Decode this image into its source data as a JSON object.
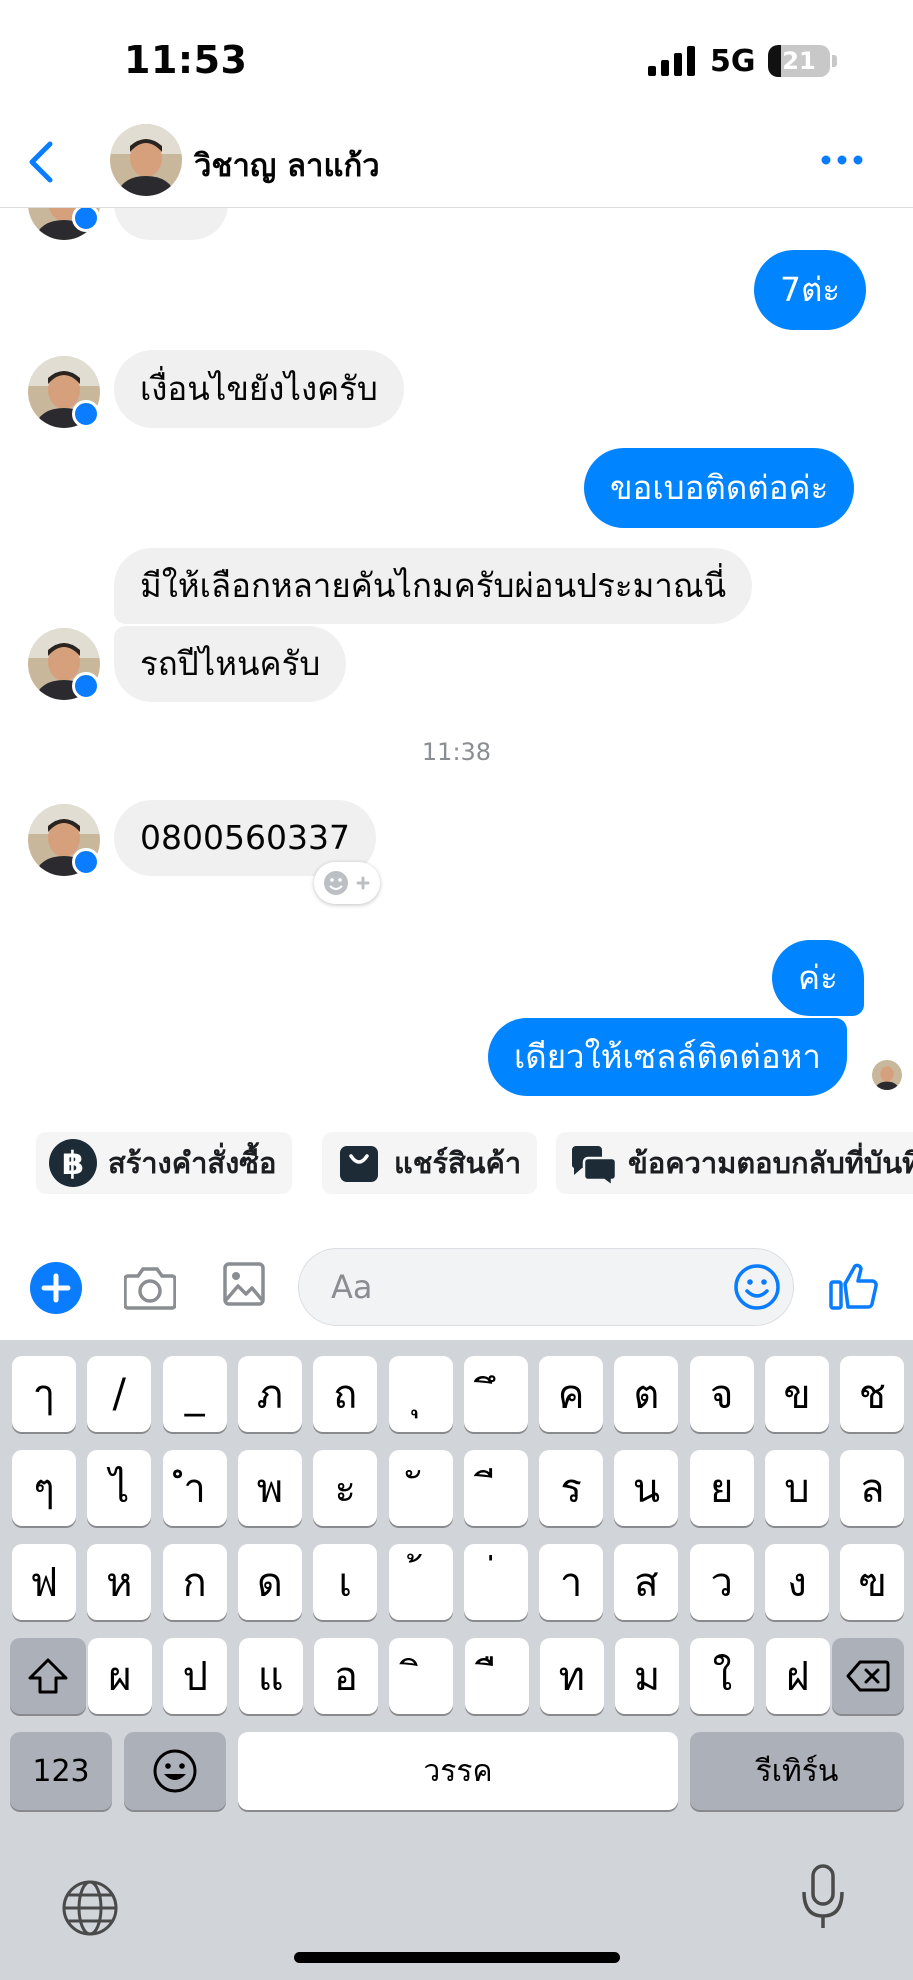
{
  "status_bar": {
    "time": "11:53",
    "network": "5G",
    "battery_level": "21",
    "battery_fraction": 0.21
  },
  "header": {
    "contact_name": "วิชาญ ลาแก้ว",
    "back_icon": "chevron-left-icon",
    "more_icon": "more-horizontal-icon"
  },
  "messages": [
    {
      "direction": "out",
      "text": "7ต่ะ"
    },
    {
      "direction": "in",
      "text": "เงื่อนไขยังไงครับ"
    },
    {
      "direction": "out",
      "text": "ขอเบอติดต่อค่ะ"
    },
    {
      "direction": "in",
      "text": "มีให้เลือกหลายคันไกมครับผ่อนประมาณนี่"
    },
    {
      "direction": "in",
      "text": "รถปีไหนครับ"
    },
    {
      "direction": "in",
      "text": "0800560337"
    },
    {
      "direction": "out",
      "text": "ค่ะ"
    },
    {
      "direction": "out",
      "text": "เดียวให้เซลล์ติดต่อหา"
    }
  ],
  "timestamp": "11:38",
  "quick_replies": [
    {
      "label": "สร้างคำสั่งซื้อ",
      "icon": "baht-icon"
    },
    {
      "label": "แชร์สินค้า",
      "icon": "shopping-bag-icon"
    },
    {
      "label": "ข้อความตอบกลับที่บันทึกไว้",
      "icon": "chat-bubbles-icon"
    }
  ],
  "composer": {
    "placeholder": "Aa",
    "accent_color": "#0a7cff"
  },
  "keyboard": {
    "row1": [
      "ๅ",
      "/",
      "_",
      "ภ",
      "ถ",
      "ุ",
      "ึ",
      "ค",
      "ต",
      "จ",
      "ข",
      "ช"
    ],
    "row2": [
      "ๆ",
      "ไ",
      "ำ",
      "พ",
      "ะ",
      "ั",
      "ี",
      "ร",
      "น",
      "ย",
      "บ",
      "ล"
    ],
    "row3": [
      "ฟ",
      "ห",
      "ก",
      "ด",
      "เ",
      "้",
      "่",
      "า",
      "ส",
      "ว",
      "ง",
      "ฃ"
    ],
    "row4": [
      "ผ",
      "ป",
      "แ",
      "อ",
      "ิ",
      "ื",
      "ท",
      "ม",
      "ใ",
      "ฝ"
    ],
    "numbers_key": "123",
    "space_key": "วรรค",
    "return_key": "รีเทิร์น"
  },
  "colors": {
    "outgoing_bubble": "#0084ff",
    "incoming_bubble": "#f0f0f0",
    "keyboard_bg": "#d1d4d9"
  }
}
